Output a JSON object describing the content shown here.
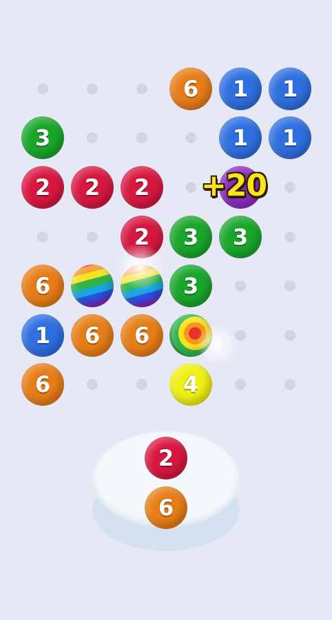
{
  "board": {
    "rows": [
      [
        {
          "type": "empty"
        },
        {
          "type": "empty"
        },
        {
          "type": "empty"
        },
        {
          "type": "ball",
          "color": "orange",
          "value": "6"
        },
        {
          "type": "ball",
          "color": "blue",
          "value": "1"
        },
        {
          "type": "ball",
          "color": "blue",
          "value": "1"
        }
      ],
      [
        {
          "type": "ball",
          "color": "green",
          "value": "3"
        },
        {
          "type": "empty"
        },
        {
          "type": "empty"
        },
        {
          "type": "empty"
        },
        {
          "type": "ball",
          "color": "blue",
          "value": "1"
        },
        {
          "type": "ball",
          "color": "blue",
          "value": "1"
        }
      ],
      [
        {
          "type": "ball",
          "color": "red",
          "value": "2"
        },
        {
          "type": "ball",
          "color": "red",
          "value": "2"
        },
        {
          "type": "ball",
          "color": "red",
          "value": "2"
        },
        {
          "type": "empty"
        },
        {
          "type": "ball",
          "color": "purple",
          "value": ""
        },
        {
          "type": "empty"
        }
      ],
      [
        {
          "type": "empty"
        },
        {
          "type": "empty"
        },
        {
          "type": "ball",
          "color": "red",
          "value": "2"
        },
        {
          "type": "ball",
          "color": "green",
          "value": "3"
        },
        {
          "type": "ball",
          "color": "green",
          "value": "3"
        },
        {
          "type": "empty"
        }
      ],
      [
        {
          "type": "ball",
          "color": "orange",
          "value": "6"
        },
        {
          "type": "ball",
          "color": "rainbow",
          "value": ""
        },
        {
          "type": "ball",
          "color": "rainbow",
          "value": ""
        },
        {
          "type": "ball",
          "color": "green",
          "value": "3"
        },
        {
          "type": "empty"
        },
        {
          "type": "empty"
        }
      ],
      [
        {
          "type": "ball",
          "color": "blue",
          "value": "1"
        },
        {
          "type": "ball",
          "color": "orange",
          "value": "6"
        },
        {
          "type": "ball",
          "color": "orange",
          "value": "6"
        },
        {
          "type": "ball",
          "color": "target",
          "value": ""
        },
        {
          "type": "empty"
        },
        {
          "type": "empty"
        }
      ],
      [
        {
          "type": "ball",
          "color": "orange",
          "value": "6"
        },
        {
          "type": "empty"
        },
        {
          "type": "empty"
        },
        {
          "type": "ball",
          "color": "yellow",
          "value": "4"
        },
        {
          "type": "empty"
        },
        {
          "type": "empty"
        }
      ]
    ]
  },
  "score_popup": "+20",
  "launcher": {
    "current": {
      "color": "red",
      "value": "2"
    },
    "next": {
      "color": "orange",
      "value": "6"
    }
  },
  "colors": {
    "background": "#e7e8f5",
    "orange": "#e77d17",
    "blue": "#2f6fe0",
    "green": "#19a62b",
    "red": "#d7173f",
    "yellow": "#efef16",
    "purple": "#8a2cc0",
    "score": "#ffe21f"
  }
}
